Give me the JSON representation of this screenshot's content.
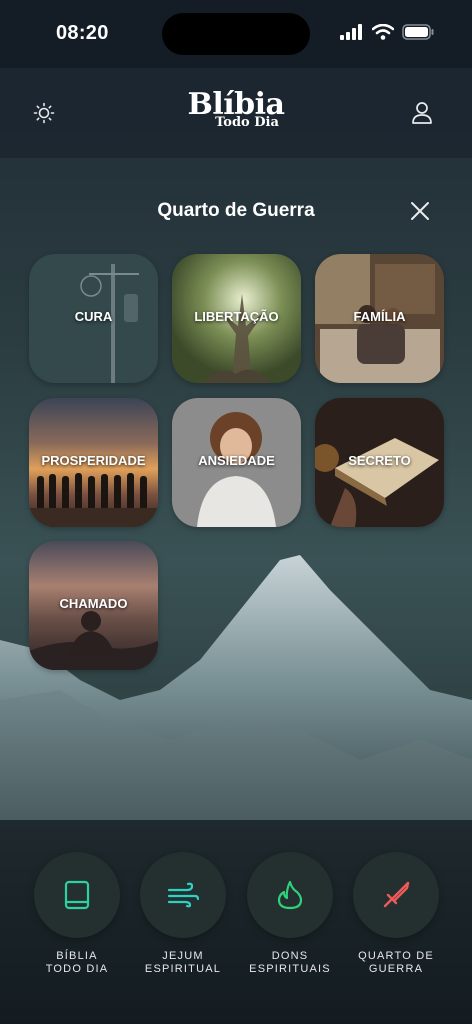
{
  "status": {
    "time": "08:20"
  },
  "header": {
    "brand_main": "Blíbia",
    "brand_sub": "Todo Dia",
    "left_icon": "sun-icon",
    "right_icon": "user-icon"
  },
  "section": {
    "title": "Quarto de Guerra"
  },
  "categories": [
    {
      "label": "CURA"
    },
    {
      "label": "LIBERTAÇÃO"
    },
    {
      "label": "FAMÍLIA"
    },
    {
      "label": "PROSPERIDADE"
    },
    {
      "label": "ANSIEDADE"
    },
    {
      "label": "SECRETO"
    },
    {
      "label": "CHAMADO"
    }
  ],
  "nav": [
    {
      "label": "BÍBLIA\nTODO DIA",
      "icon": "book-icon",
      "color": "#2fd1a0"
    },
    {
      "label": "JEJUM\nESPIRITUAL",
      "icon": "wind-icon",
      "color": "#2fd1c4"
    },
    {
      "label": "DONS\nESPIRITUAIS",
      "icon": "flame-icon",
      "color": "#2fd17a"
    },
    {
      "label": "QUARTO DE\nGUERRA",
      "icon": "sword-icon",
      "color": "#ee5a5a"
    }
  ]
}
